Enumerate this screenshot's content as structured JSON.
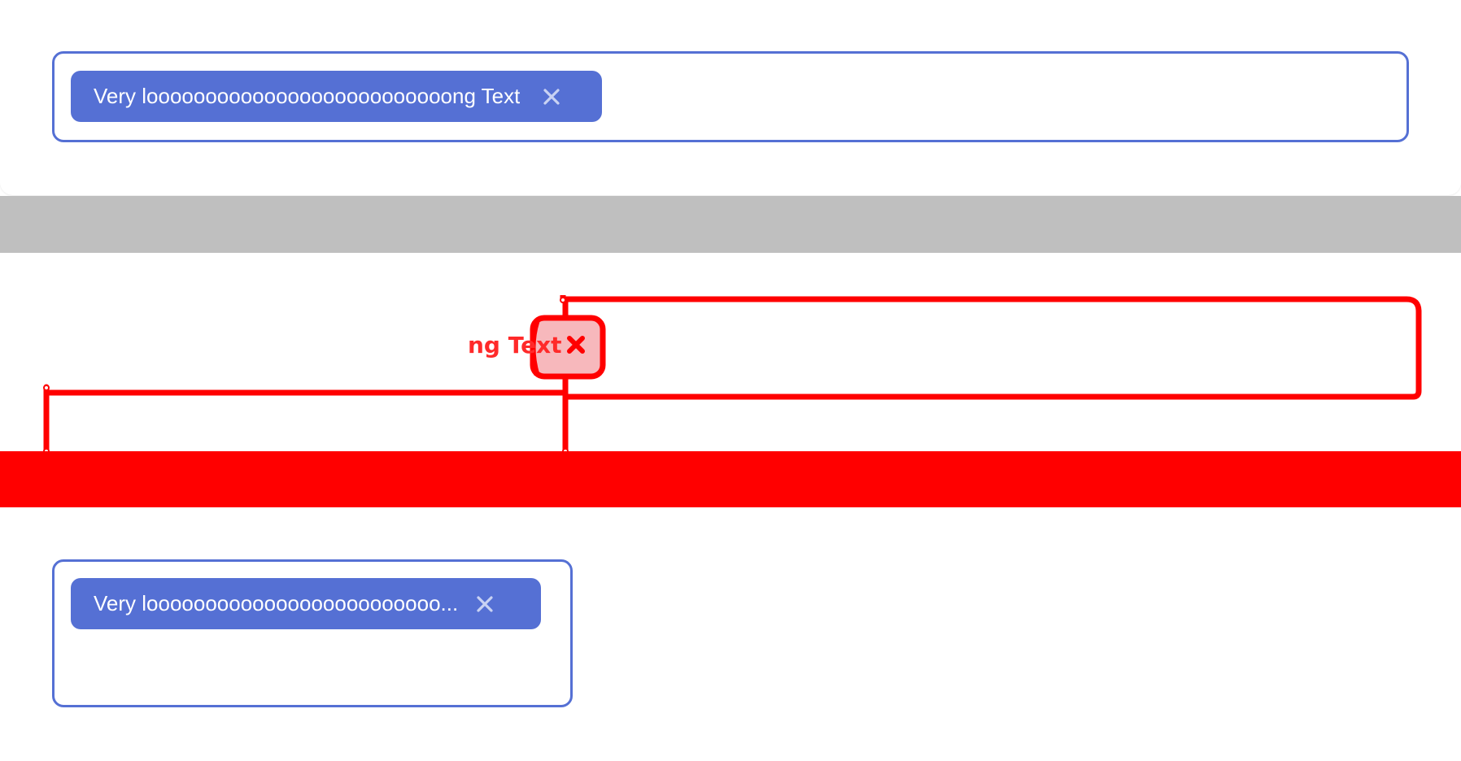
{
  "colors": {
    "accent": "#5570d4",
    "chip_text": "#ffffff",
    "diff_highlight": "#ff0000",
    "divider_gray": "#bfbfbf"
  },
  "top_example": {
    "chip_label": "Very loooooooooooooooooooooooooong Text",
    "close_icon": "close-icon"
  },
  "diff_overlay": {
    "fragment_text": "ng Text"
  },
  "bottom_example": {
    "chip_label": "Very looooooooooooooooooooooooo...",
    "close_icon": "close-icon"
  }
}
